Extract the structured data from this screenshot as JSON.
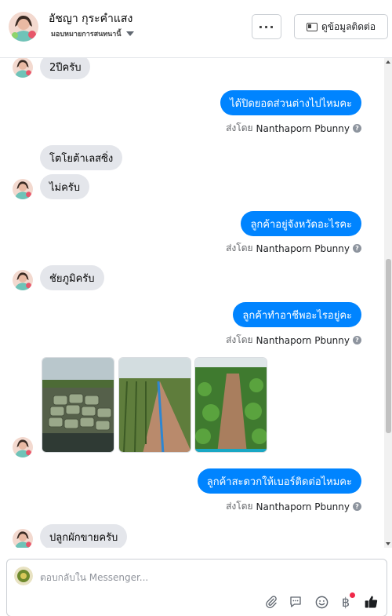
{
  "header": {
    "contact_name": "อัชญา กุระคำแสง",
    "assigned_label": "มอบหมายการสนทนานี้",
    "more_label": "···",
    "view_info_label": "ดูข้อมูลติดต่อ"
  },
  "messages": {
    "in_1": "2ปีครับ",
    "out_1": "ได้ปิดยอดส่วนต่างไปไหมคะ",
    "in_2": "โตโยต้าเลสซิ่ง",
    "in_3": "ไม่ครับ",
    "out_2": "ลูกค้าอยู่จังหวัดอะไรคะ",
    "in_4": "ชัยภูมิครับ",
    "out_3": "ลูกค้าทำอาชีพอะไรอยู่คะ",
    "out_4": "ลูกค้าสะดวกให้เบอร์ติดต่อไหมคะ",
    "in_5": "ปลูกผักขายครับ"
  },
  "sent_by": {
    "prefix": "ส่งโดย",
    "agent": "Nanthaporn Pbunny"
  },
  "composer": {
    "placeholder": "ตอบกลับใน Messenger..."
  },
  "colors": {
    "outgoing_bubble": "#0084ff",
    "incoming_bubble": "#e4e6eb",
    "notification_dot": "#f02849"
  },
  "icons": [
    "more-icon",
    "contact-card-icon",
    "chevron-down-icon",
    "attachment-icon",
    "saved-replies-icon",
    "emoji-icon",
    "baht-payment-icon",
    "thumbs-up-icon",
    "help-icon"
  ]
}
